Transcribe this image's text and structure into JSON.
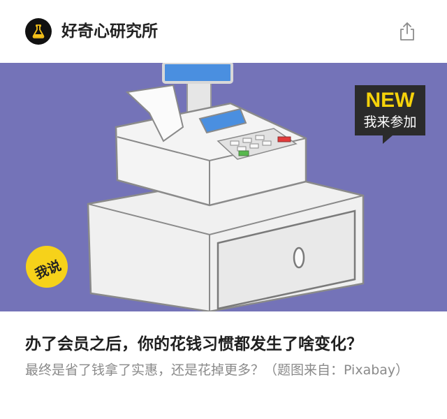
{
  "header": {
    "brand_name": "好奇心研究所",
    "logo_icon": "flask-icon",
    "share_icon": "share-icon"
  },
  "hero": {
    "image_subject": "cash-register-illustration",
    "background_color": "#7473b8",
    "new_badge": {
      "new_label": "NEW",
      "join_label": "我来参加"
    },
    "say_badge_label": "我说"
  },
  "article": {
    "title": "办了会员之后，你的花钱习惯都发生了啥变化？",
    "subtitle": "最终是省了钱拿了实惠，还是花掉更多？（题图来自：Pixabay）"
  },
  "colors": {
    "accent_yellow": "#f6d21a",
    "dark": "#2b2b2b",
    "muted_text": "#8a8a8a"
  }
}
